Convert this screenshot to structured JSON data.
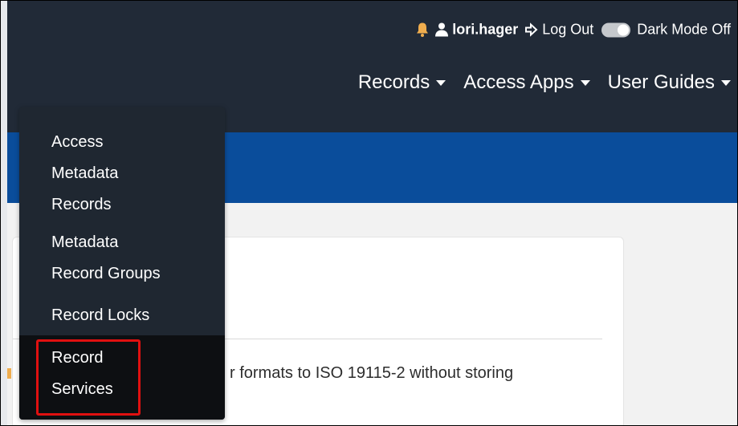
{
  "userbar": {
    "username": "lori.hager",
    "logout_label": "Log Out",
    "dark_mode_label": "Dark Mode Off"
  },
  "menu": {
    "records_label": "Records",
    "access_apps_label": "Access Apps",
    "user_guides_label": "User Guides"
  },
  "dropdown": {
    "items": [
      {
        "lines": [
          "Access",
          "Metadata",
          "Records"
        ]
      },
      {
        "lines": [
          "Metadata",
          "Record Groups"
        ]
      },
      {
        "lines": [
          "Record Locks"
        ]
      },
      {
        "lines": [
          "Record",
          "Services"
        ]
      }
    ]
  },
  "card": {
    "description": "r formats to ISO 19115-2 without storing"
  },
  "colors": {
    "navbar": "#212a37",
    "banner": "#0a4d9b",
    "dropdown": "#1f2731",
    "active_item": "#0d0f12",
    "highlight": "#e01010",
    "bell": "#f0ad4e"
  },
  "icons": {
    "bell": "bell-icon",
    "user": "user-icon",
    "logout": "logout-icon",
    "toggle": "dark-mode-toggle"
  }
}
